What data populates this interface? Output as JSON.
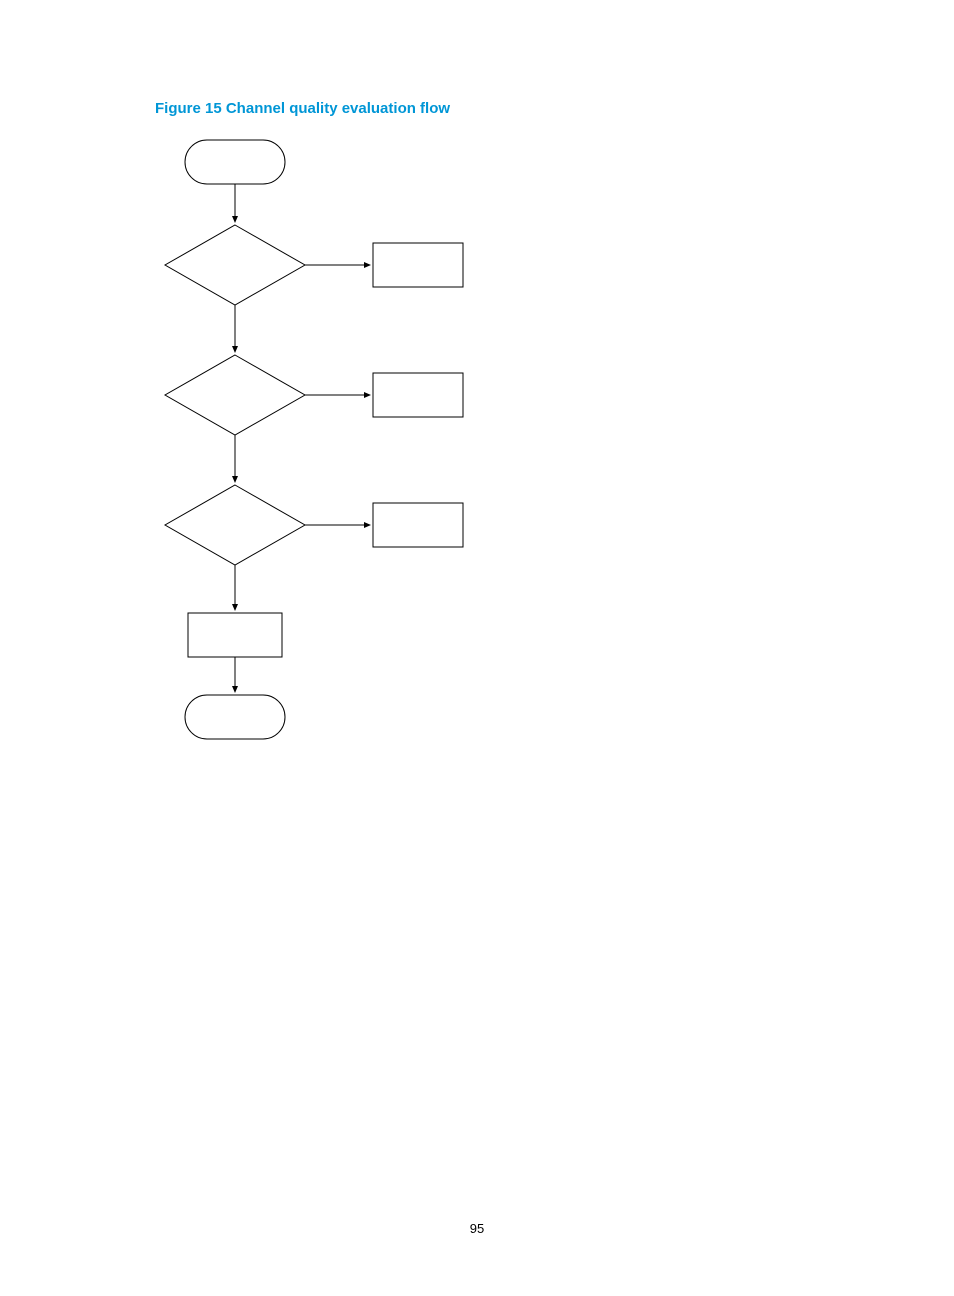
{
  "figure": {
    "title": "Figure 15 Channel quality evaluation flow"
  },
  "page_number": "95"
}
